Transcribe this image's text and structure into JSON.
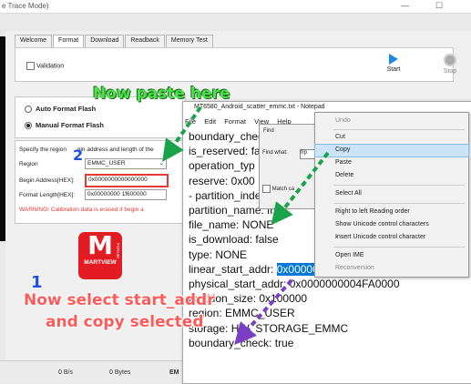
{
  "window": {
    "title": "e Trace Mode)",
    "minimize": "—",
    "maximize": "☐"
  },
  "tabs": [
    "Welcome",
    "Format",
    "Download",
    "Readback",
    "Memory Test"
  ],
  "top_panel": {
    "validation_label": "Validation",
    "start_label": "Start",
    "stop_label": "Stop"
  },
  "format_options": {
    "auto": "Auto Format Flash",
    "manual": "Manual Format Flash"
  },
  "region_panel": {
    "description": "Specify the region",
    "description_tail": "gin address and length of the",
    "region_label": "Region",
    "region_value": "EMMC_USER",
    "begin_label": "Begin Address[HEX]:",
    "begin_value": "0x0000000000000000",
    "length_label": "Format Length[HEX]:",
    "length_value": "0x00000000 1f600000",
    "warning": "WARNING! Calibration data is erased if begin a"
  },
  "logo": {
    "brand": "MARTVIEW",
    "forum": "FORUM",
    "letter": "M"
  },
  "status_bar": {
    "speed": "0 B/s",
    "bytes": "0 Bytes",
    "storage": "EM"
  },
  "notepad": {
    "title": "MT6580_Android_scatter_emmc.txt - Notepad",
    "menu": [
      "File",
      "Edit",
      "Format",
      "View",
      "Help"
    ],
    "lines": [
      "boundary_chec",
      "is_reserved: fa",
      "operation_typ",
      "reserve: 0x00",
      "",
      "- partition_index: SYS13",
      "partition_name: frp",
      "file_name: NONE",
      "is_download: false",
      "type: NONE"
    ],
    "start_addr_prefix": "linear_start_addr: ",
    "start_addr_value": "0x0000000004FA0000",
    "lines_after": [
      "physical_start_addr: 0x0000000004FA0000",
      "partition_size: 0x100000",
      "region: EMMC_USER",
      "storage: HW_STORAGE_EMMC",
      "boundary_check: true"
    ]
  },
  "find_dialog": {
    "title": "Find",
    "find_what_label": "Find what:",
    "find_what_value": "frp",
    "match_label": "Match ca"
  },
  "context_menu": {
    "items": [
      {
        "label": "Undo",
        "enabled": false
      },
      {
        "label": "Cut",
        "enabled": true
      },
      {
        "label": "Copy",
        "enabled": true,
        "highlighted": true
      },
      {
        "label": "Paste",
        "enabled": true
      },
      {
        "label": "Delete",
        "enabled": true
      },
      {
        "label": "Select All",
        "enabled": true
      },
      {
        "label": "Right to left Reading order",
        "enabled": true
      },
      {
        "label": "Show Unicode control characters",
        "enabled": true
      },
      {
        "label": "Insert Unicode control character",
        "enabled": true
      },
      {
        "label": "Open IME",
        "enabled": true
      },
      {
        "label": "Reconversion",
        "enabled": false
      }
    ]
  },
  "annotations": {
    "paste_here": "Now paste here",
    "step1_number": "1",
    "step2_number": "2",
    "select_line1": "Now select start_addr",
    "select_line2": "and copy selected"
  },
  "colors": {
    "accent": "#0078d7",
    "annotation_green": "#4ce04c",
    "annotation_red": "#ff5a5a",
    "logo_red": "#e31b23"
  }
}
